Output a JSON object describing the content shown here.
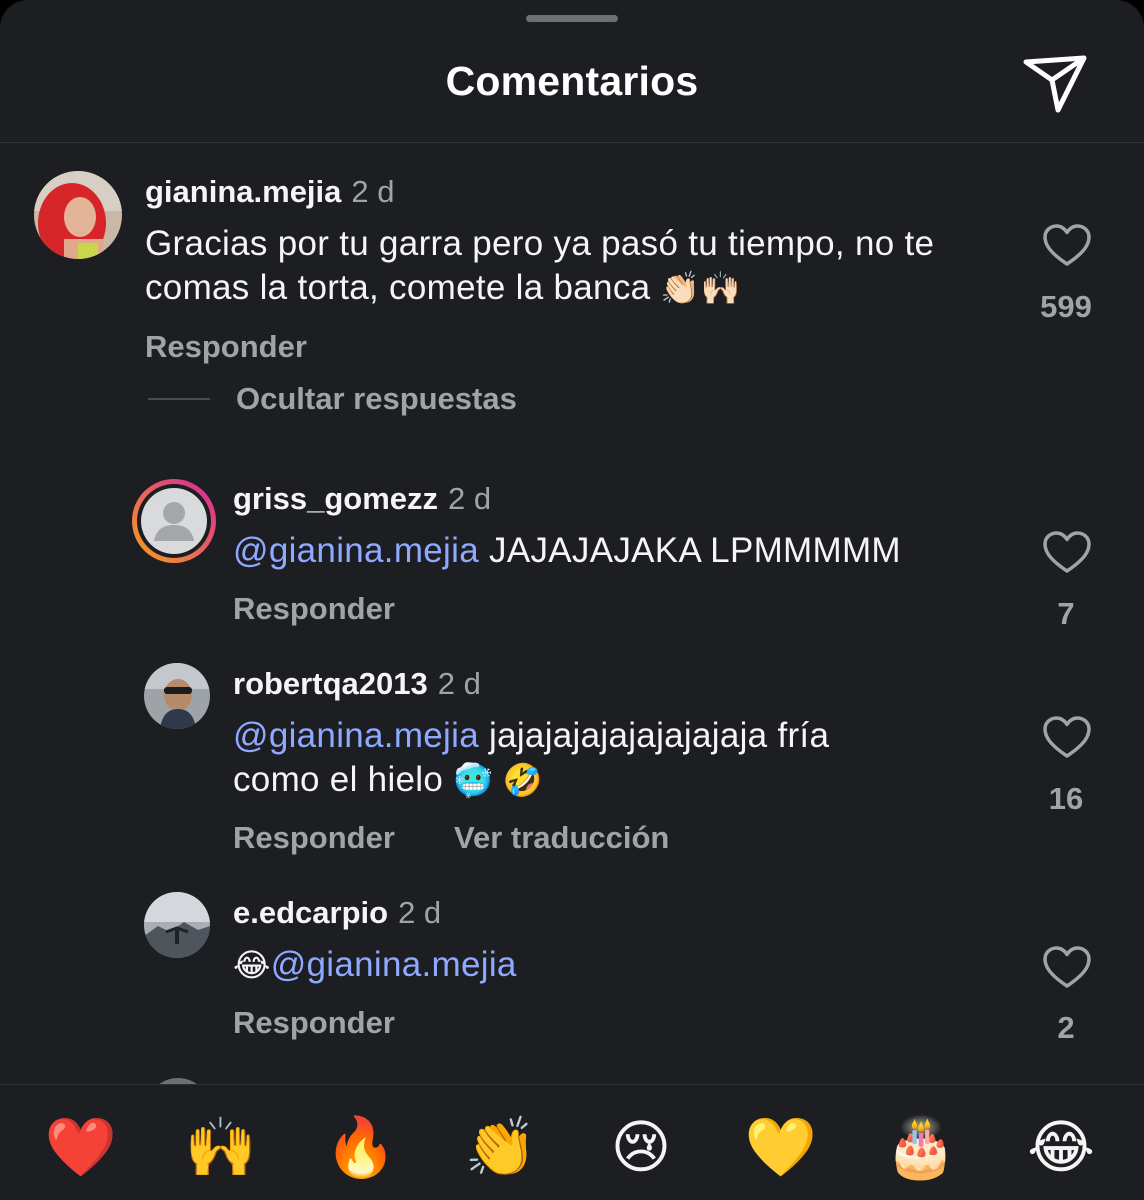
{
  "header": {
    "title": "Comentarios",
    "send_icon": "send-icon"
  },
  "comments": [
    {
      "username": "gianina.mejia",
      "time": "2 d",
      "text": "Gracias por tu garra pero ya pasó tu tiempo, no te comas la torta, comete la banca",
      "emoji": "👏🏻🙌🏻",
      "likes": "599",
      "reply": "Responder",
      "hide_replies": "Ocultar respuestas"
    }
  ],
  "replies": [
    {
      "username": "griss_gomezz",
      "time": "2 d",
      "mention": "@gianina.mejia",
      "text": "JAJAJAJAKA LPMMMMM",
      "likes": "7",
      "reply": "Responder"
    },
    {
      "username": "robertqa2013",
      "time": "2 d",
      "mention": "@gianina.mejia",
      "text_line1": "jajajajajajajajajaja fría",
      "text_line2": "como el hielo",
      "emoji": "🥶 🤣",
      "likes": "16",
      "reply": "Responder",
      "translate": "Ver traducción"
    },
    {
      "username": "e.edcarpio",
      "time": "2 d",
      "emoji": "😂",
      "mention": "@gianina.mejia",
      "likes": "2",
      "reply": "Responder"
    }
  ],
  "reactions": [
    "❤️",
    "🙌",
    "🔥",
    "👏",
    "😢",
    "💛",
    "🎂",
    "😂"
  ],
  "colors": {
    "background": "#1c1e22",
    "mention": "#8ea9ff",
    "muted": "#a0a3a8",
    "story_ring_start": "#f7a21c",
    "story_ring_end": "#d6249f"
  }
}
